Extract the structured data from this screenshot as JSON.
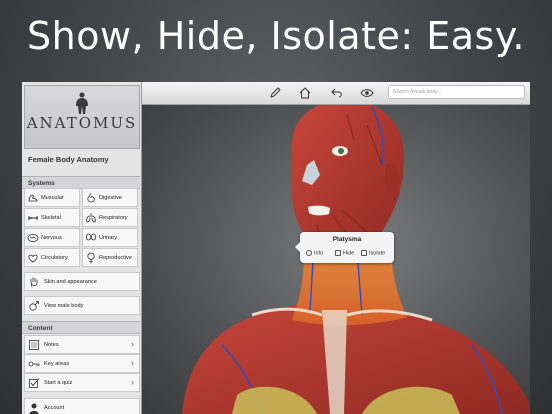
{
  "headline": "Show, Hide, Isolate: Easy.",
  "logo": {
    "text": "ANATOMUS"
  },
  "app_title": "Female Body Anatomy",
  "systems": {
    "header": "Systems",
    "items": [
      {
        "label": "Muscular",
        "icon": "muscle-icon"
      },
      {
        "label": "Digestive",
        "icon": "stomach-icon"
      },
      {
        "label": "Skeletal",
        "icon": "bone-icon"
      },
      {
        "label": "Respiratory",
        "icon": "lungs-icon"
      },
      {
        "label": "Nervous",
        "icon": "brain-icon"
      },
      {
        "label": "Urinary",
        "icon": "kidneys-icon"
      },
      {
        "label": "Circulatory",
        "icon": "heart-icon"
      },
      {
        "label": "Reproductive",
        "icon": "female-symbol-icon"
      }
    ]
  },
  "skin_label": "Skin and appearance",
  "view_male_label": "View male body",
  "content": {
    "header": "Content",
    "items": [
      {
        "label": "Notes",
        "icon": "notes-icon"
      },
      {
        "label": "Key areas",
        "icon": "key-icon"
      },
      {
        "label": "Start a quiz",
        "icon": "checkbox-icon"
      }
    ]
  },
  "account_label": "Account",
  "toolbar": {
    "icons": [
      "pencil-icon",
      "home-icon",
      "undo-icon",
      "eye-icon"
    ],
    "search_placeholder": "Search female body..."
  },
  "popup": {
    "title": "Platysma",
    "info_label": "Info",
    "hide_label": "Hide",
    "isolate_label": "Isolate"
  },
  "colors": {
    "muscle": "#b83a32",
    "highlight": "#e8742a",
    "sidebar_bg": "#e4e4e5"
  }
}
